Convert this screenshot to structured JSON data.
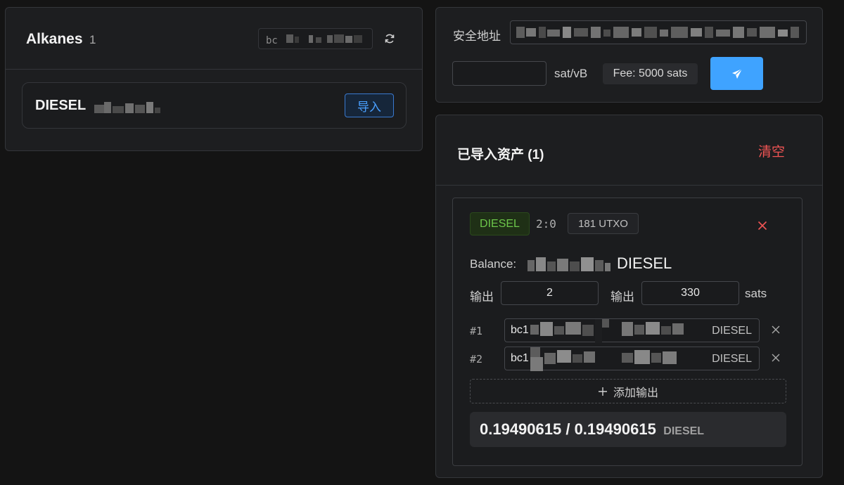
{
  "left_card": {
    "title": "Alkanes",
    "count": "1",
    "address_prefix": "bc",
    "refresh_icon": "refresh-icon",
    "token": {
      "name": "DIESEL",
      "import_label": "导入"
    }
  },
  "send_card": {
    "address_label": "安全地址",
    "fee_rate_value": "",
    "fee_rate_unit": "sat/vB",
    "fee_label": "Fee: 5000 sats",
    "send_icon": "send-icon"
  },
  "assets_card": {
    "title": "已导入资产 (1)",
    "clear_label": "清空",
    "asset": {
      "tag": "DIESEL",
      "id": "2:0",
      "utxo_label": "181 UTXO",
      "balance_label": "Balance:",
      "balance_unit": "DIESEL",
      "outputs_label_1": "输出",
      "outputs_count": "2",
      "outputs_label_2": "输出",
      "output_sats": "330",
      "sats_unit": "sats",
      "rows": [
        {
          "index": "#1",
          "address_prefix": "bc1",
          "unit": "DIESEL"
        },
        {
          "index": "#2",
          "address_prefix": "bc1",
          "unit": "DIESEL"
        }
      ],
      "add_output_label": "添加输出",
      "total": "0.19490615 / 0.19490615",
      "total_unit": "DIESEL"
    }
  },
  "colors": {
    "accent": "#3fa3ff",
    "danger": "#f05454",
    "success": "#6cc64a",
    "background": "#141414",
    "card": "#1d1e20"
  }
}
